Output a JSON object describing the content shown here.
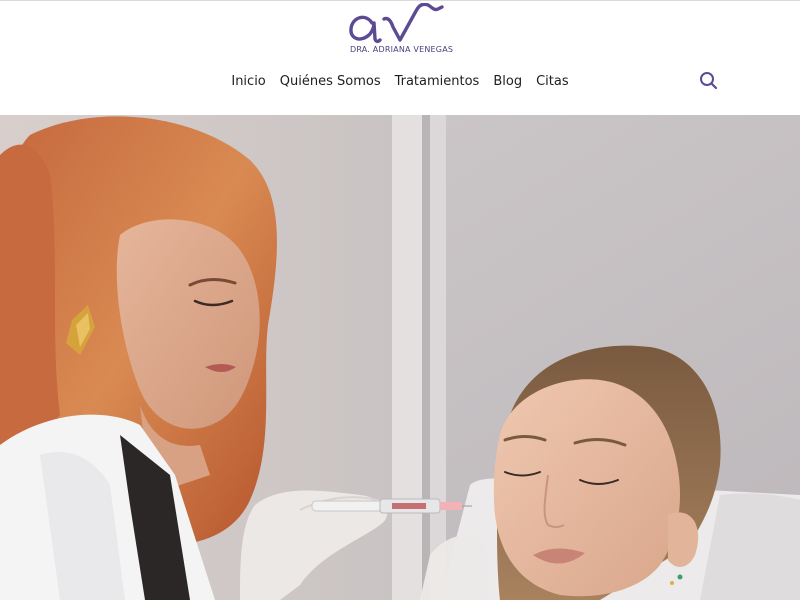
{
  "brand": {
    "logo_text": "DRA. ADRIANA VENEGAS",
    "logo_icon": "av-monogram-icon",
    "color": "#5d4a94"
  },
  "nav": {
    "items": [
      {
        "label": "Inicio"
      },
      {
        "label": "Quiénes Somos"
      },
      {
        "label": "Tratamientos"
      },
      {
        "label": "Blog"
      },
      {
        "label": "Citas"
      }
    ]
  },
  "search": {
    "icon": "search-icon",
    "color": "#5d4a94"
  },
  "hero": {
    "image": "doctor-applying-injection-to-patient-photo"
  }
}
